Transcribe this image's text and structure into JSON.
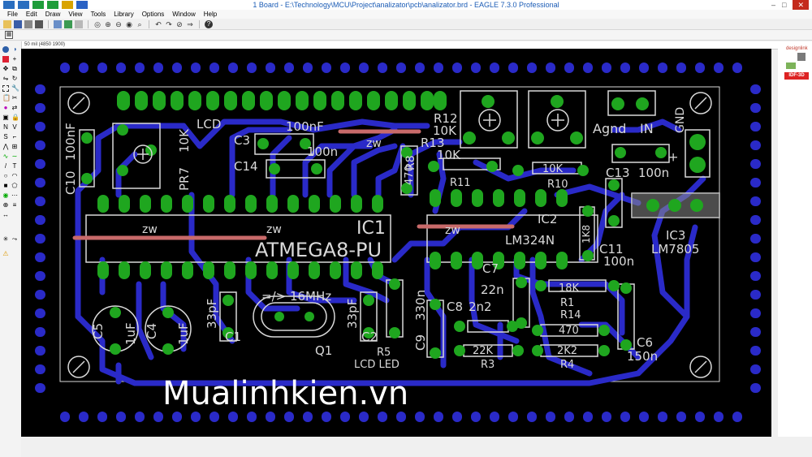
{
  "window": {
    "title": "1 Board - E:\\Technology\\MCU\\Project\\analizator\\pcb\\analizator.brd - EAGLE 7.3.0 Professional",
    "controls": [
      "–",
      "□",
      "✕"
    ]
  },
  "menu": [
    "File",
    "Edit",
    "Draw",
    "View",
    "Tools",
    "Library",
    "Options",
    "Window",
    "Help"
  ],
  "toolbar_icons": [
    "open-icon",
    "save-icon",
    "print-icon",
    "cam-icon",
    "schematic-icon",
    "board-icon",
    "script-icon",
    "zoom-fit-icon",
    "zoom-in-icon",
    "zoom-out-icon",
    "zoom-redraw-icon",
    "zoom-select-icon",
    "undo-icon",
    "redo-icon",
    "stop-icon",
    "go-icon",
    "help-icon"
  ],
  "param_icon": "grid-icon",
  "coordinate_readout": "50 mil (4850 1900)",
  "right_panel": {
    "logo_text": "designlink",
    "idf_label": "IDF-3D"
  },
  "pcb": {
    "labels": {
      "lcd": "LCD",
      "c3": "C3",
      "c3_val": "100nF",
      "c14": "C14",
      "c14_val": "100n",
      "c10": "C10",
      "c10_val": "100nF",
      "pr7": "PR7",
      "pr7_val": "10K",
      "zw1": "zw",
      "zw2": "zw",
      "zw3": "zw",
      "zw4": "zw",
      "ic1": "IC1",
      "ic1_part": "ATMEGA8-PU",
      "c2": "C2",
      "c2_val": "33pF",
      "c1": "C1",
      "c1_val": "33pF",
      "freq": "=/> 16MHz",
      "q1": "Q1",
      "c5": "C5",
      "c5_val": "1uF",
      "c4": "C4",
      "c4_val": "1uF",
      "r5": "R5",
      "lcd_led": "LCD LED",
      "r12": "R12",
      "r12_val": "10K",
      "r13": "R13",
      "r13_val": "10K",
      "r8": "R8",
      "r8_val": "470",
      "r11": "R11",
      "r10": "R10",
      "r10_val": "10K",
      "agnd": "Agnd",
      "in": "IN",
      "gnd": "GND",
      "plus": "+",
      "c13": "C13",
      "c13_val": "100n",
      "ic2": "IC2",
      "ic2_part": "LM324N",
      "r9_val": "1K8",
      "c11": "C11",
      "c11_val": "100n",
      "ic3": "IC3",
      "ic3_part": "LM7805",
      "c7": "C7",
      "c7_val": "22n",
      "c8": "C8",
      "c8_val": "2n2",
      "c9": "C9",
      "c9_val": "330n",
      "r1": "R1",
      "r1_val": "18K",
      "r14": "R14",
      "r14_val": "470",
      "r3": "R3",
      "r3_val": "22K",
      "r4": "R4",
      "r4_val": "2K2",
      "c6": "C6",
      "c6_val": "150n"
    },
    "watermark": "Mualinhkien.vn",
    "colors": {
      "background": "#000000",
      "bottom_copper": "#2a2ac8",
      "pad": "#1fa61f",
      "silkscreen": "#d9d9d9",
      "airwire": "#c86a6a"
    }
  }
}
